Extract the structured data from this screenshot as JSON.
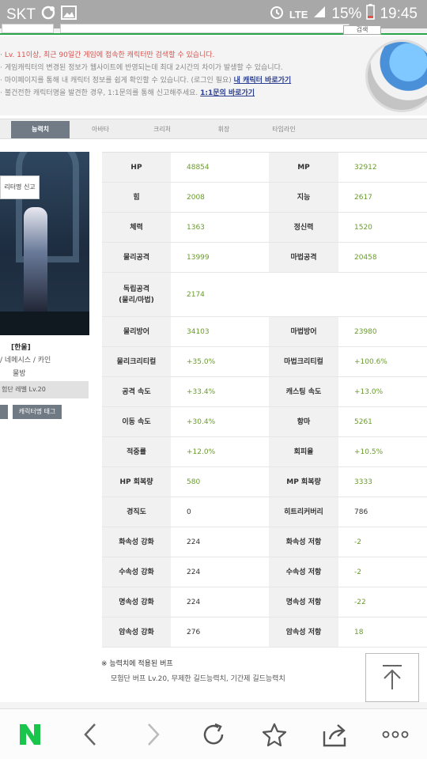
{
  "status": {
    "carrier": "SKT",
    "network": "LTE",
    "battery": "15%",
    "time": "19:45"
  },
  "search": {
    "button_label": "검색"
  },
  "notices": [
    {
      "text": "Lv. 11이상, 최근 90일간 게임에 접속한 캐릭터만 검색할 수 있습니다.",
      "link": ""
    },
    {
      "text": "게임캐릭터의 변경된 정보가 웹사이트에 반영되는데 최대 2시간의 차이가 발생할 수 있습니다.",
      "link": ""
    },
    {
      "text": "마이페이지를 통해 내 캐릭터 정보를 쉽게 확인할 수 있습니다. (로그인 필요)",
      "link": "내 캐릭터 바로가기"
    },
    {
      "text": "불건전한 캐릭터명을 발견한 경우, 1:1문의를 통해 신고해주세요.",
      "link": "1:1문의 바로가기"
    }
  ],
  "tabs": [
    "능력치",
    "아바타",
    "크리처",
    "휘장",
    "타임라인"
  ],
  "character": {
    "report_button": "리터명 신고",
    "name": "[한울]",
    "info": "/ 네메시스 / 카인",
    "guild": "물방",
    "adventure": "험단 레벨 Lv.20",
    "button1": "",
    "button2": "캐릭터명 태그"
  },
  "stats": [
    {
      "l1": "HP",
      "v1": "48854",
      "l2": "MP",
      "v2": "32912"
    },
    {
      "l1": "힘",
      "v1": "2008",
      "l2": "지능",
      "v2": "2617"
    },
    {
      "l1": "체력",
      "v1": "1363",
      "l2": "정신력",
      "v2": "1520"
    },
    {
      "l1": "물리공격",
      "v1": "13999",
      "l2": "마법공격",
      "v2": "20458"
    },
    {
      "l1": "독립공격\n(물리/마법)",
      "v1": "2174",
      "l2": "",
      "v2": ""
    },
    {
      "l1": "물리방어",
      "v1": "34103",
      "l2": "마법방어",
      "v2": "23980"
    },
    {
      "l1": "물리크리티컬",
      "v1": "+35.0%",
      "l2": "마법크리티컬",
      "v2": "+100.6%"
    },
    {
      "l1": "공격 속도",
      "v1": "+33.4%",
      "l2": "캐스팅 속도",
      "v2": "+13.0%"
    },
    {
      "l1": "이동 속도",
      "v1": "+30.4%",
      "l2": "항마",
      "v2": "5261"
    },
    {
      "l1": "적중률",
      "v1": "+12.0%",
      "l2": "회피율",
      "v2": "+10.5%"
    },
    {
      "l1": "HP 회복량",
      "v1": "580",
      "l2": "MP 회복량",
      "v2": "3333"
    },
    {
      "l1": "경직도",
      "v1": "0",
      "l2": "히트리커버리",
      "v2": "786"
    },
    {
      "l1": "화속성 강화",
      "v1": "224",
      "l2": "화속성 저항",
      "v2": "-2"
    },
    {
      "l1": "수속성 강화",
      "v1": "224",
      "l2": "수속성 저항",
      "v2": "-2"
    },
    {
      "l1": "명속성 강화",
      "v1": "224",
      "l2": "명속성 저항",
      "v2": "-22"
    },
    {
      "l1": "암속성 강화",
      "v1": "276",
      "l2": "암속성 저항",
      "v2": "18"
    }
  ],
  "buffs": {
    "title": "※ 능력치에 적용된 버프",
    "detail": "모험단 버프 Lv.20, 무제한 길드능력치, 기간제 길드능력치"
  },
  "nav": {
    "icons": [
      "naver-logo-icon",
      "back-icon",
      "forward-icon",
      "refresh-icon",
      "bookmark-star-icon",
      "share-icon",
      "more-icon"
    ]
  },
  "colors": {
    "accent_green": "#2aa64a",
    "value_green": "#6a9b2d",
    "tab_active": "#707b86",
    "notice_red": "#d9534f"
  }
}
